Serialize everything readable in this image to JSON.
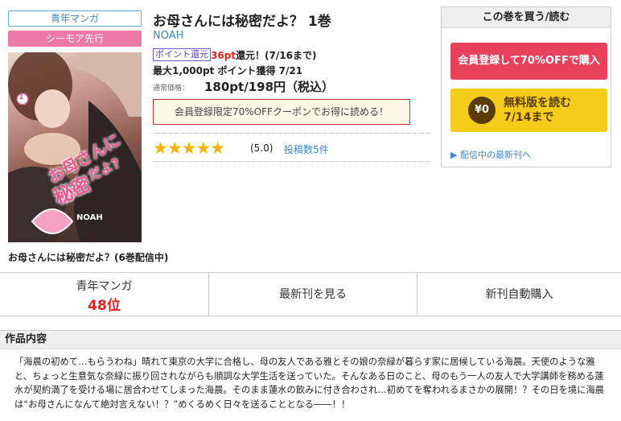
{
  "badges": {
    "genre": "青年マンガ",
    "store": "シーモア先行"
  },
  "cover": {
    "line1": "お母さんには",
    "line2": "秘密",
    "line3": "だよ?",
    "publisher": "NOAH",
    "volume": "1"
  },
  "book": {
    "title": "お母さんには秘密だよ？ 1巻",
    "author": "NOAH",
    "points_tag": "ポイント還元",
    "points_amount": "36pt",
    "points_text": "還元！(7/16まで)",
    "max_points": "最大1,000pt ポイント獲得 7/21",
    "price_label": "通常価格：",
    "price": "180pt/198円（税込）",
    "coupon": "会員登録限定70%OFFクーポンでお得に読める！",
    "stars": "★★★★★",
    "rating": "(5.0)",
    "reviews": "投稿数5件"
  },
  "panel": {
    "title": "この巻を買う/読む",
    "register_btn": "会員登録して70%OFFで購入",
    "free_icon": "¥0",
    "free_line1": "無料版を読む",
    "free_line2": "7/14まで",
    "latest_link": "▶ 配信中の最新刊へ"
  },
  "series": "お母さんには秘密だよ？(6巻配信中)",
  "actions": {
    "genre_label": "青年マンガ",
    "rank": "48位",
    "latest": "最新刊を見る",
    "auto_buy": "新刊自動購入"
  },
  "content": {
    "heading": "作品内容",
    "description": "「海晨の初めて…もらうわね」晴れて東京の大学に合格し、母の友人である雅とその娘の奈緑が暮らす家に居候している海晨。天使のような雅と、ちょっと生意気な奈緑に振り回されながらも順調な大学生活を送っていた。そんなある日のこと、母のもう一人の友人で大学講師を務める蓮水が契約満了を受ける場に居合わせてしまった海晨。そのまま蓮水の飲みに付き合わされ…初めてを奪われるまさかの展開！？その日を境に海晨は“お母さんになんて絶対言えない！？”めくるめく日々を送ることとなる――！！"
  }
}
